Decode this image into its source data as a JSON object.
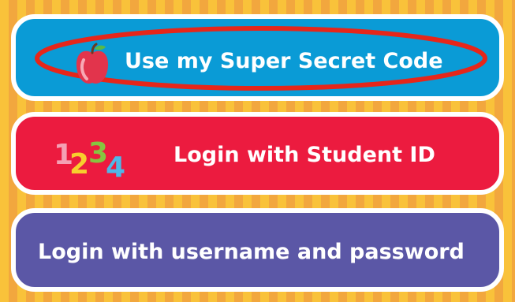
{
  "buttons": {
    "secret_code": {
      "label": "Use my Super Secret Code",
      "color": "#0a9bd6",
      "icon": "apple-icon",
      "highlight_color": "#e6261a"
    },
    "student_id": {
      "label": "Login with Student ID",
      "color": "#ec1b3f",
      "icon": "digits-1234-icon",
      "icon_text": [
        "1",
        "2",
        "3",
        "4"
      ],
      "icon_colors": [
        "#f4a0b4",
        "#f7cf2d",
        "#86c440",
        "#4fb7e8"
      ]
    },
    "username_password": {
      "label": "Login with username and password",
      "color": "#5b57a6"
    }
  }
}
